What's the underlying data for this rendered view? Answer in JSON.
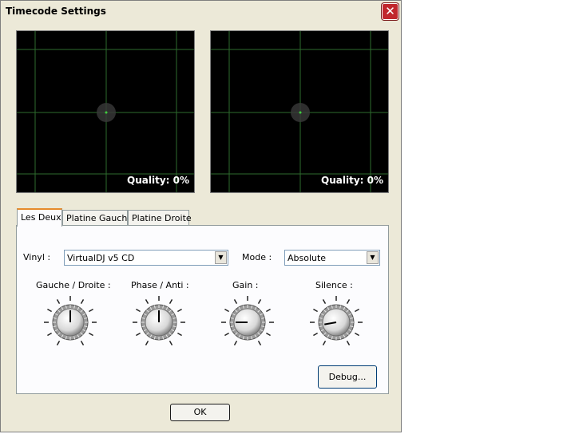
{
  "window": {
    "title": "Timecode Settings",
    "close_glyph": "✕"
  },
  "scopes": [
    {
      "quality": "Quality: 0%"
    },
    {
      "quality": "Quality: 0%"
    }
  ],
  "tabs": [
    {
      "label": "Les Deux",
      "active": true
    },
    {
      "label": "Platine Gauche",
      "active": false
    },
    {
      "label": "Platine Droite",
      "active": false
    }
  ],
  "form": {
    "vinyl_label": "Vinyl :",
    "vinyl_value": "VirtualDJ v5 CD",
    "mode_label": "Mode :",
    "mode_value": "Absolute"
  },
  "knobs": [
    {
      "label": "Gauche / Droite :",
      "angle_deg": 0
    },
    {
      "label": "Phase / Anti :",
      "angle_deg": 0
    },
    {
      "label": "Gain :",
      "angle_deg": -90
    },
    {
      "label": "Silence :",
      "angle_deg": -100
    }
  ],
  "buttons": {
    "debug": "Debug...",
    "ok": "OK"
  },
  "icons": {
    "dropdown": "▼"
  },
  "colors": {
    "scope_grid": "#2e6b2e",
    "close_red": "#c1272d",
    "tab_accent": "#e68b2c"
  }
}
